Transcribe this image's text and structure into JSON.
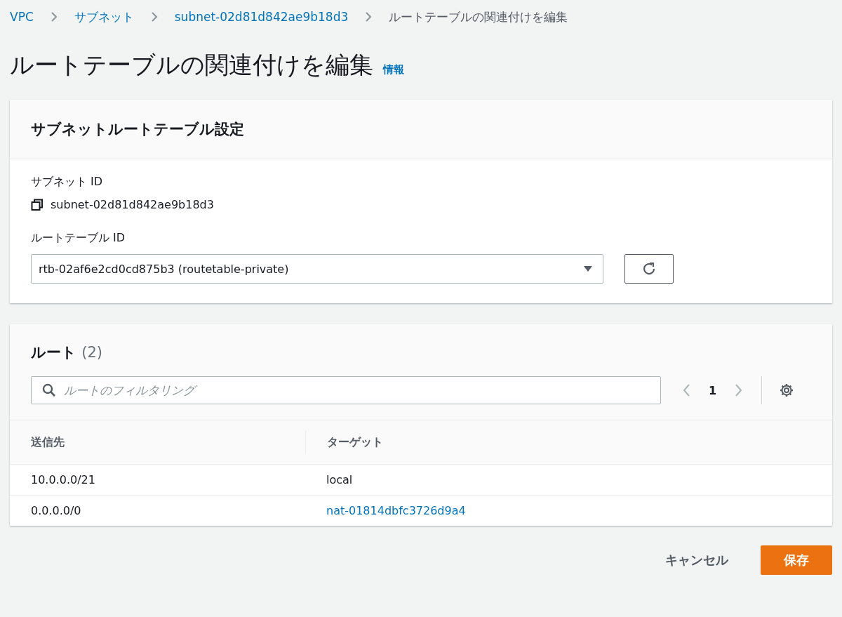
{
  "breadcrumb": [
    {
      "label": "VPC",
      "link": true
    },
    {
      "label": "サブネット",
      "link": true
    },
    {
      "label": "subnet-02d81d842ae9b18d3",
      "link": true
    },
    {
      "label": "ルートテーブルの関連付けを編集",
      "link": false
    }
  ],
  "page_title": "ルートテーブルの関連付けを編集",
  "info_link": "情報",
  "settings_card": {
    "title": "サブネットルートテーブル設定",
    "subnet_label": "サブネット ID",
    "subnet_id": "subnet-02d81d842ae9b18d3",
    "route_table_label": "ルートテーブル ID",
    "route_table_value": "rtb-02af6e2cd0cd875b3 (routetable-private)"
  },
  "routes_card": {
    "title": "ルート",
    "count": "(2)",
    "search": {
      "placeholder": "ルートのフィルタリング"
    },
    "page": "1",
    "columns": [
      "送信先",
      "ターゲット"
    ],
    "rows": [
      {
        "destination": "10.0.0.0/21",
        "target": "local",
        "target_link": false
      },
      {
        "destination": "0.0.0.0/0",
        "target": "nat-01814dbfc3726d9a4",
        "target_link": true
      }
    ]
  },
  "buttons": {
    "cancel": "キャンセル",
    "save": "保存"
  }
}
